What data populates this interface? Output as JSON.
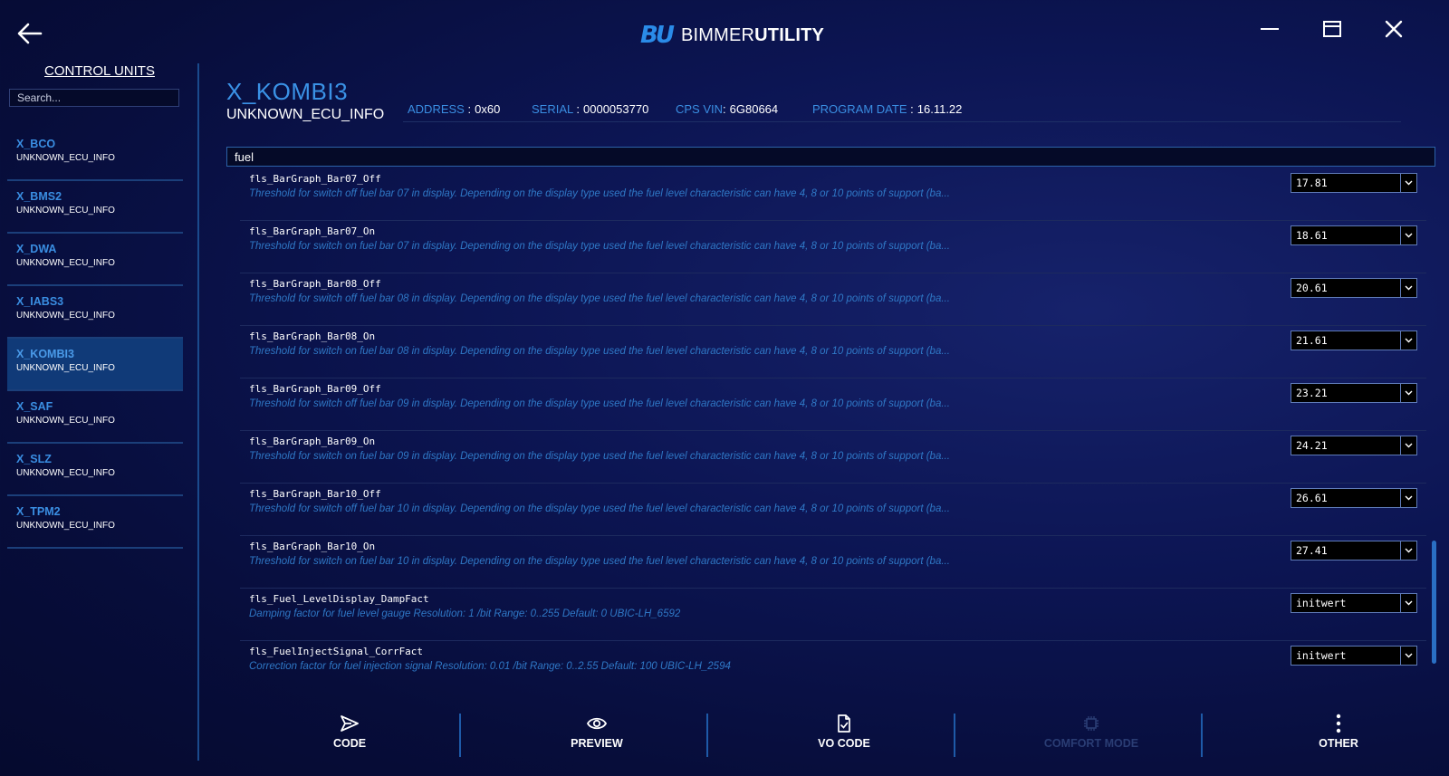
{
  "app": {
    "logo_mark": "BU",
    "logo_prefix": "BIMMER",
    "logo_suffix": "UTILITY"
  },
  "icons": {
    "back": "arrow-left-icon",
    "minimize": "minimize-icon",
    "maximize": "maximize-icon",
    "close": "close-icon"
  },
  "sidebar": {
    "title": "CONTROL UNITS",
    "search_placeholder": "Search...",
    "units": [
      {
        "name": "X_BCO",
        "sub": "UNKNOWN_ECU_INFO"
      },
      {
        "name": "X_BMS2",
        "sub": "UNKNOWN_ECU_INFO"
      },
      {
        "name": "X_DWA",
        "sub": "UNKNOWN_ECU_INFO"
      },
      {
        "name": "X_IABS3",
        "sub": "UNKNOWN_ECU_INFO"
      },
      {
        "name": "X_KOMBI3",
        "sub": "UNKNOWN_ECU_INFO",
        "active": true
      },
      {
        "name": "X_SAF",
        "sub": "UNKNOWN_ECU_INFO"
      },
      {
        "name": "X_SLZ",
        "sub": "UNKNOWN_ECU_INFO"
      },
      {
        "name": "X_TPM2",
        "sub": "UNKNOWN_ECU_INFO"
      }
    ]
  },
  "ecu": {
    "title": "X_KOMBI3",
    "subtitle": "UNKNOWN_ECU_INFO",
    "address_label": "ADDRESS",
    "address": "0x60",
    "serial_label": "SERIAL",
    "serial": "0000053770",
    "vin_label": "CPS VIN",
    "vin": "6G80664",
    "program_date_label": "PROGRAM DATE",
    "program_date": "16.11.22",
    "separator": ":"
  },
  "filter": {
    "value": "fuel"
  },
  "params": [
    {
      "name": "fls_BarGraph_Bar07_Off",
      "desc": "Threshold for switch off fuel bar 07 in display. Depending on the display type used the fuel level characteristic can have 4, 8 or 10 points of support (ba...",
      "value": "17.81"
    },
    {
      "name": "fls_BarGraph_Bar07_On",
      "desc": "Threshold for switch on fuel bar 07 in display. Depending on the display type used the fuel level characteristic can have 4, 8 or 10 points of support (ba...",
      "value": "18.61"
    },
    {
      "name": "fls_BarGraph_Bar08_Off",
      "desc": "Threshold for switch off fuel bar 08 in display. Depending on the display type used the fuel level characteristic can have 4, 8 or 10 points of support (ba...",
      "value": "20.61"
    },
    {
      "name": "fls_BarGraph_Bar08_On",
      "desc": "Threshold for switch on fuel bar 08 in display. Depending on the display type used the fuel level characteristic can have 4, 8 or 10 points of support (ba...",
      "value": "21.61"
    },
    {
      "name": "fls_BarGraph_Bar09_Off",
      "desc": "Threshold for switch off fuel bar 09 in display. Depending on the display type used the fuel level characteristic can have 4, 8 or 10 points of support (ba...",
      "value": "23.21"
    },
    {
      "name": "fls_BarGraph_Bar09_On",
      "desc": "Threshold for switch on fuel bar 09 in display. Depending on the display type used the fuel level characteristic can have 4, 8 or 10 points of support (ba...",
      "value": "24.21"
    },
    {
      "name": "fls_BarGraph_Bar10_Off",
      "desc": "Threshold for switch off fuel bar 10 in display. Depending on the display type used the fuel level characteristic can have 4, 8 or 10 points of support (ba...",
      "value": "26.61"
    },
    {
      "name": "fls_BarGraph_Bar10_On",
      "desc": "Threshold for switch on fuel bar 10 in display. Depending on the display type used the fuel level characteristic can have 4, 8 or 10 points of support (ba...",
      "value": "27.41"
    },
    {
      "name": "fls_Fuel_LevelDisplay_DampFact",
      "desc": "Damping factor for fuel level gauge Resolution: 1 /bit Range: 0..255 Default: 0 UBIC-LH_6592",
      "value": "initwert"
    },
    {
      "name": "fls_FuelInjectSignal_CorrFact",
      "desc": "Correction factor for fuel injection signal Resolution: 0.01 /bit Range: 0..2.55 Default: 100 UBIC-LH_2594",
      "value": "initwert"
    }
  ],
  "toolbar": {
    "code": "CODE",
    "preview": "PREVIEW",
    "vo_code": "VO CODE",
    "comfort_mode": "COMFORT MODE",
    "other": "OTHER"
  },
  "colors": {
    "accent": "#3a8ee2",
    "background": "#0a1245",
    "active_item": "#103a78",
    "description": "#2f78c6"
  }
}
